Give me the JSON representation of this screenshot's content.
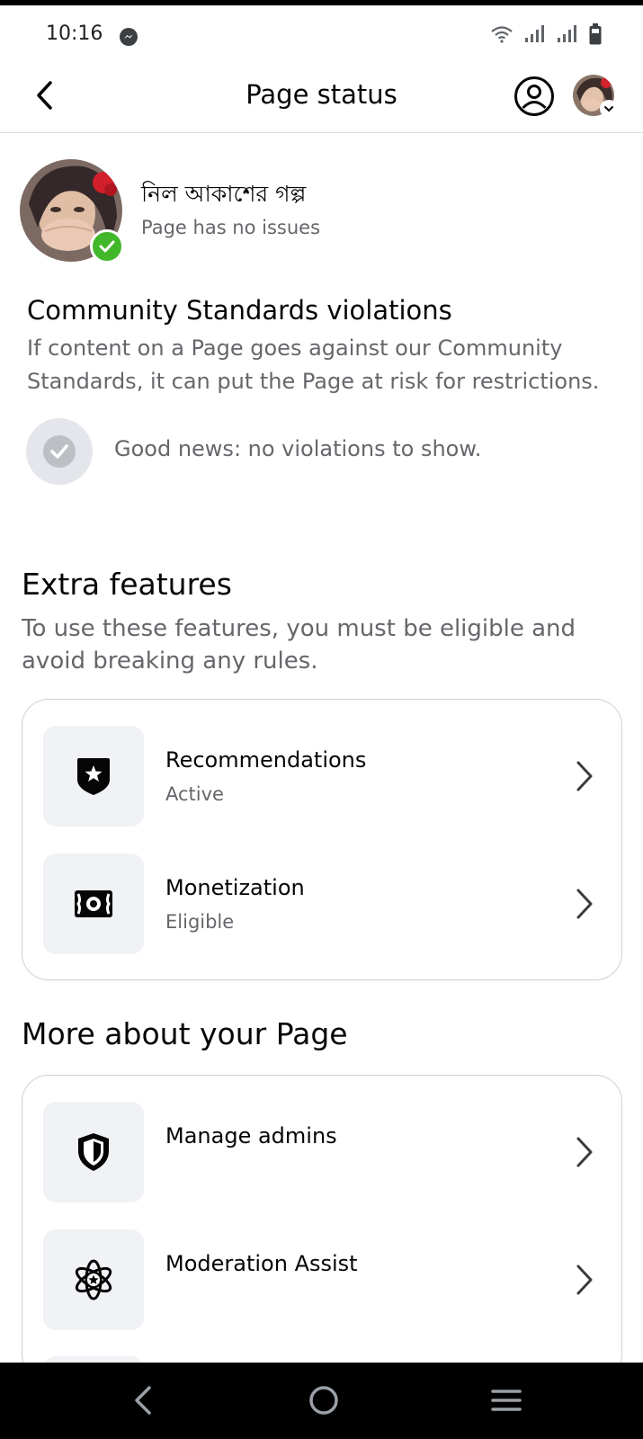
{
  "status_bar": {
    "time": "10:16"
  },
  "header": {
    "title": "Page status"
  },
  "page": {
    "name": "নিল আকাশের গল্প",
    "status": "Page has no issues"
  },
  "community": {
    "heading": "Community Standards violations",
    "description": "If content on a Page goes against our Community Standards, it can put the Page at risk for restrictions.",
    "empty_message": "Good news: no violations to show."
  },
  "extra_features": {
    "heading": "Extra features",
    "description": "To use these features, you must be eligible and avoid breaking any rules.",
    "items": [
      {
        "title": "Recommendations",
        "subtitle": "Active",
        "icon": "star-shield-icon"
      },
      {
        "title": "Monetization",
        "subtitle": "Eligible",
        "icon": "money-icon"
      }
    ]
  },
  "more_about": {
    "heading": "More about your Page",
    "items": [
      {
        "title": "Manage admins",
        "icon": "shield-icon"
      },
      {
        "title": "Moderation Assist",
        "icon": "atom-star-icon"
      }
    ]
  },
  "colors": {
    "accent_green": "#42b72a",
    "secondary_text": "#65676b",
    "icon_bg": "#f0f2f5",
    "border": "#ced0d4"
  }
}
